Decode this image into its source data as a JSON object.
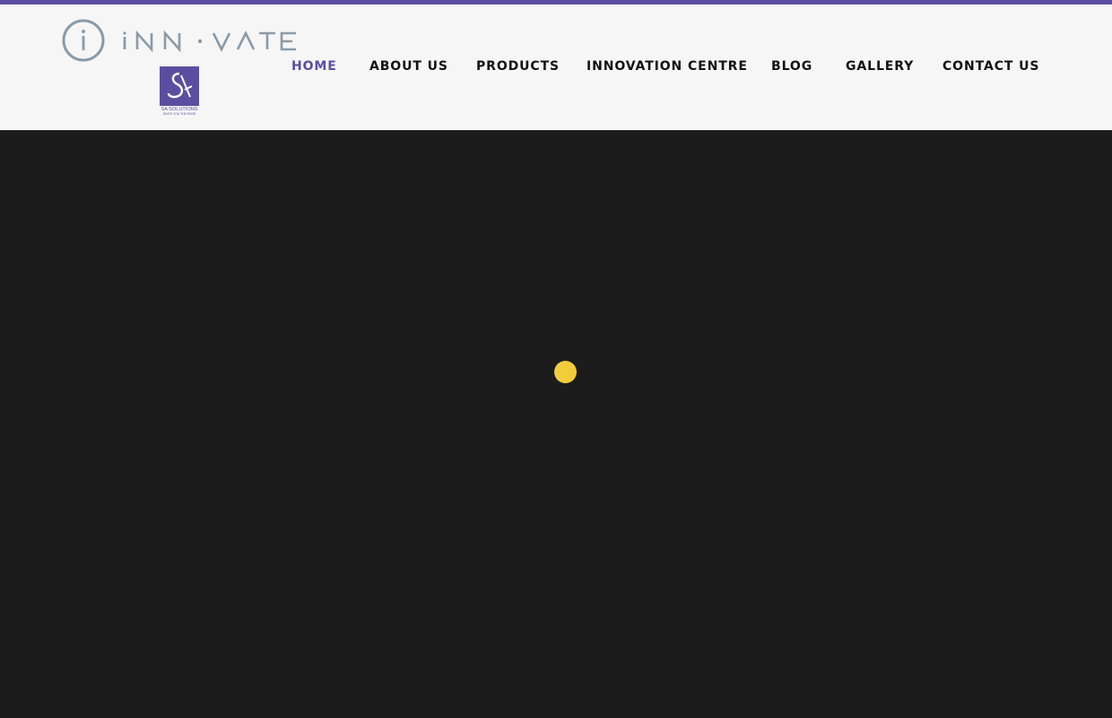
{
  "brand": {
    "name": "iNNOVATE",
    "partner_name": "SA SOLUTIONS",
    "partner_tagline": "GIVES YOU THE EDGE",
    "accent_color": "#5b4ea0",
    "logo_grey": "#8a9aa8"
  },
  "nav": {
    "items": [
      {
        "label": "HOME",
        "active": true
      },
      {
        "label": "ABOUT US",
        "active": false
      },
      {
        "label": "PRODUCTS",
        "active": false
      },
      {
        "label": "INNOVATION CENTRE",
        "active": false
      },
      {
        "label": "BLOG",
        "active": false
      },
      {
        "label": "GALLERY",
        "active": false
      },
      {
        "label": "CONTACT US",
        "active": false
      }
    ]
  },
  "main": {
    "background": "#1c1c1c",
    "loader_color": "#f2cd3b",
    "loader_icon": "loading-dot-icon"
  }
}
